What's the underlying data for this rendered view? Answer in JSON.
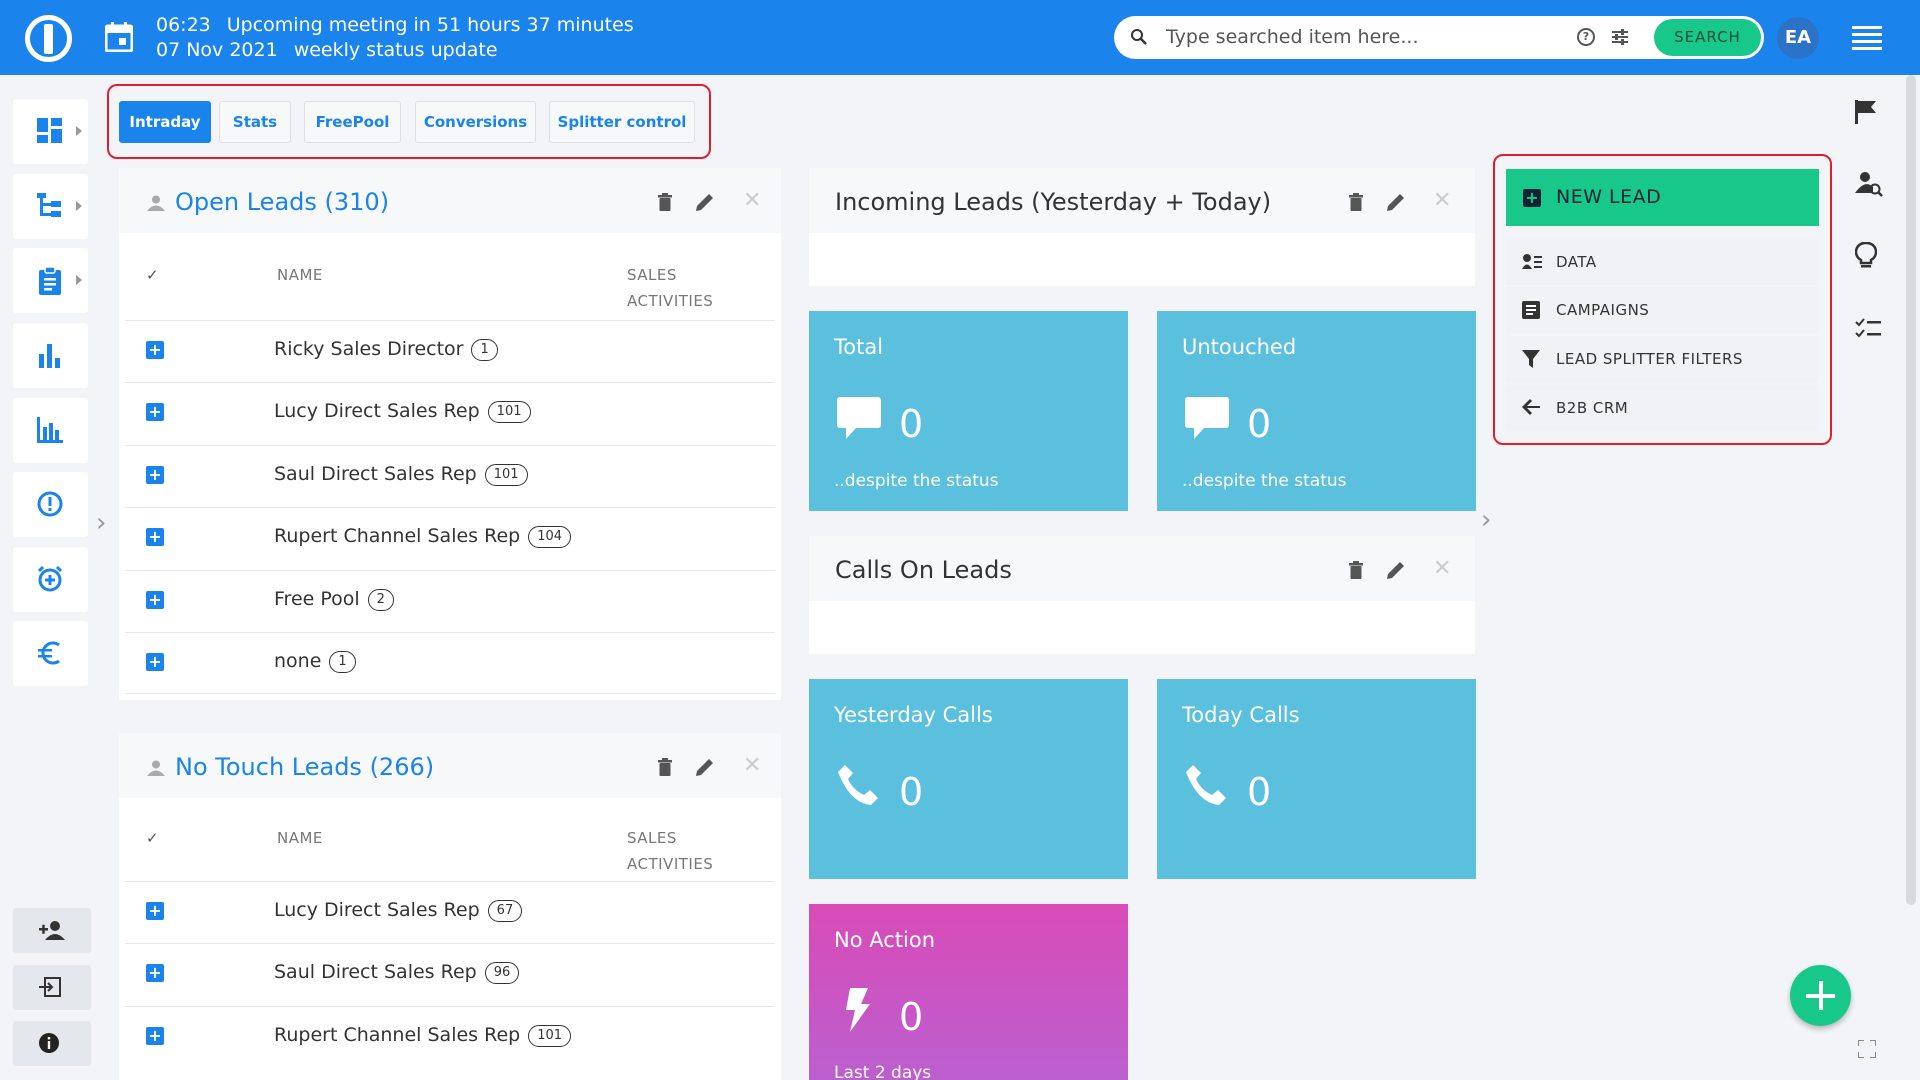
{
  "header": {
    "time": "06:23",
    "meeting": "Upcoming meeting in 51 hours 37 minutes",
    "date": "07 Nov 2021",
    "meeting_title": "weekly status update",
    "search_placeholder": "Type searched item here...",
    "search_button": "SEARCH",
    "avatar_initials": "EA"
  },
  "tabs": [
    {
      "label": "Intraday",
      "active": true
    },
    {
      "label": "Stats"
    },
    {
      "label": "FreePool"
    },
    {
      "label": "Conversions"
    },
    {
      "label": "Splitter control"
    }
  ],
  "open_leads": {
    "title": "Open Leads (310)",
    "col_check": "✓",
    "col_name": "NAME",
    "col_sales": "SALES ACTIVITIES",
    "rows": [
      {
        "name": "Ricky Sales Director",
        "count": "1"
      },
      {
        "name": "Lucy Direct Sales Rep",
        "count": "101"
      },
      {
        "name": "Saul Direct Sales Rep",
        "count": "101"
      },
      {
        "name": "Rupert Channel Sales Rep",
        "count": "104"
      },
      {
        "name": "Free Pool",
        "count": "2"
      },
      {
        "name": "none",
        "count": "1"
      }
    ]
  },
  "no_touch_leads": {
    "title": "No Touch Leads (266)",
    "col_check": "✓",
    "col_name": "NAME",
    "col_sales": "SALES ACTIVITIES",
    "rows": [
      {
        "name": "Lucy Direct Sales Rep",
        "count": "67"
      },
      {
        "name": "Saul Direct Sales Rep",
        "count": "96"
      },
      {
        "name": "Rupert Channel Sales Rep",
        "count": "101"
      }
    ]
  },
  "incoming": {
    "title": "Incoming Leads (Yesterday + Today)"
  },
  "calls": {
    "title": "Calls On Leads"
  },
  "tiles": {
    "total": {
      "title": "Total",
      "value": "0",
      "sub": "..despite the status"
    },
    "untouched": {
      "title": "Untouched",
      "value": "0",
      "sub": "..despite the status"
    },
    "yesterday": {
      "title": "Yesterday Calls",
      "value": "0"
    },
    "today": {
      "title": "Today Calls",
      "value": "0"
    },
    "noaction": {
      "title": "No Action",
      "value": "0",
      "sub": "Last 2 days"
    }
  },
  "actions": {
    "new_lead": "NEW LEAD",
    "items": [
      "DATA",
      "CAMPAIGNS",
      "LEAD SPLITTER FILTERS",
      "B2B CRM"
    ]
  },
  "colors": {
    "brand": "#1a83ec",
    "accent_green": "#18c88a",
    "tile_blue": "#5bc0de",
    "highlight_red": "#e01e2e"
  }
}
